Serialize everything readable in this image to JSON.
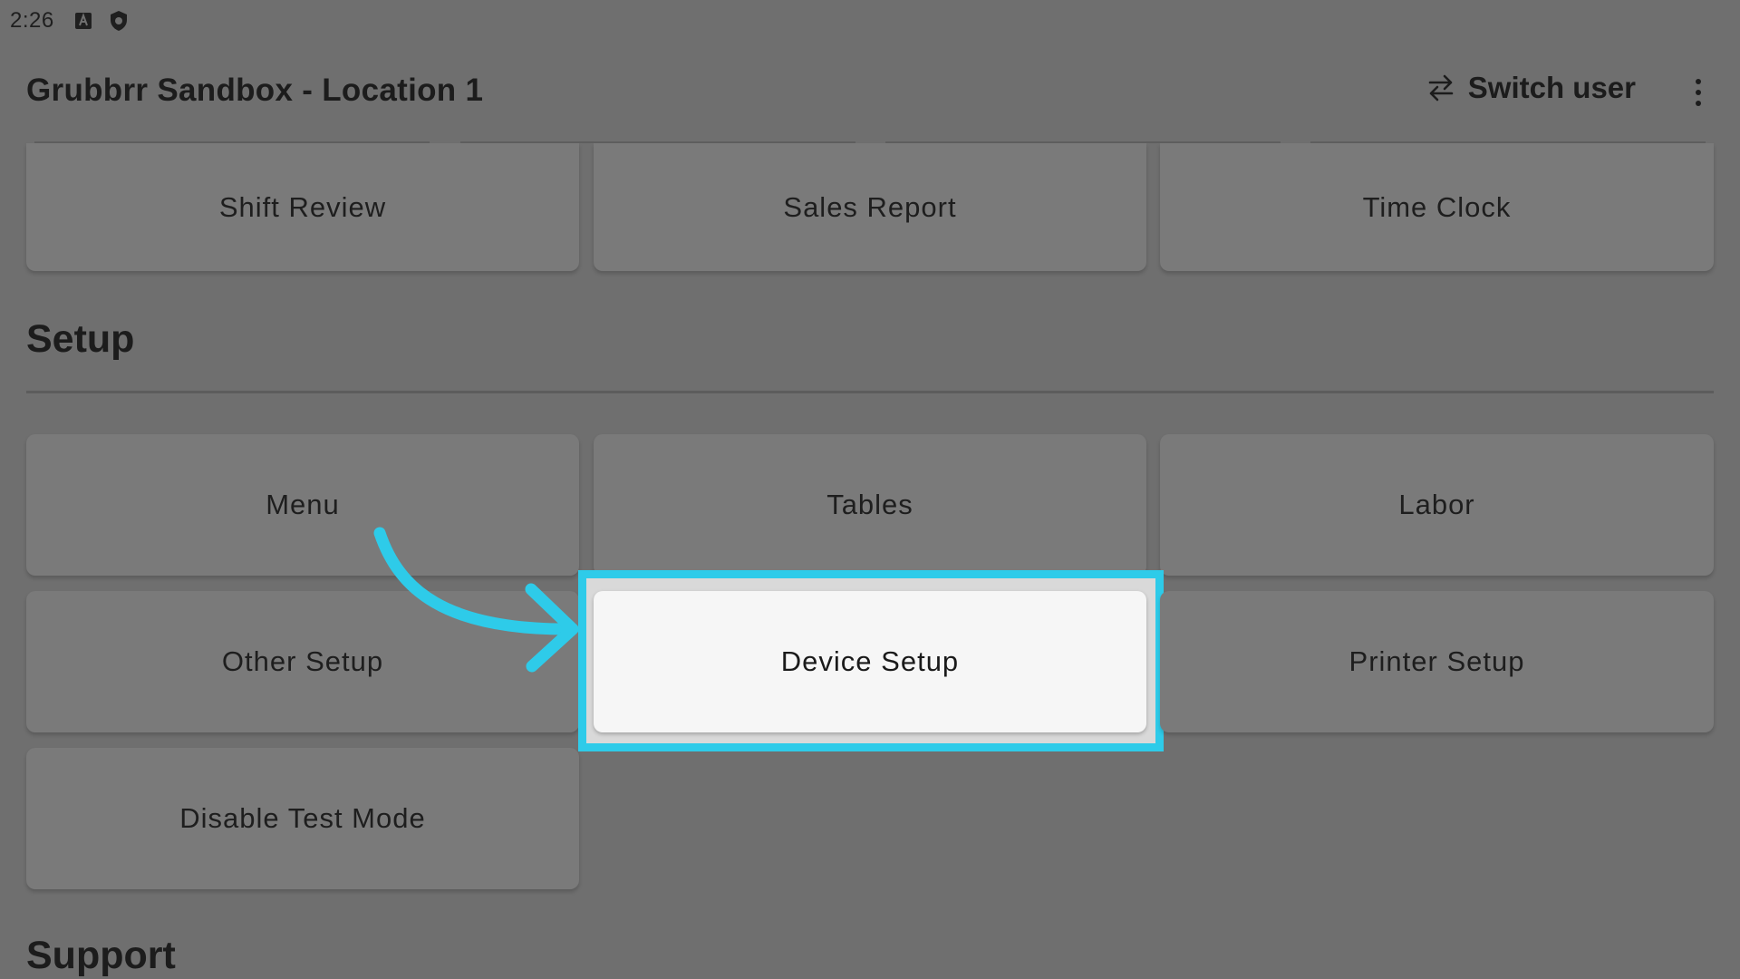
{
  "status_bar": {
    "time": "2:26",
    "icons": [
      "a-badge-icon",
      "shield-icon"
    ]
  },
  "app_bar": {
    "title": "Grubbrr Sandbox - Location 1",
    "switch_user_label": "Switch user",
    "switch_user_icon": "swap-arrows-icon",
    "menu_icon": "more-vert-icon"
  },
  "reports": {
    "items": [
      {
        "label": "Shift Review"
      },
      {
        "label": "Sales Report"
      },
      {
        "label": "Time Clock"
      }
    ]
  },
  "setup": {
    "title": "Setup",
    "items": [
      {
        "label": "Menu"
      },
      {
        "label": "Tables"
      },
      {
        "label": "Labor"
      },
      {
        "label": "Other Setup"
      },
      {
        "label": "Device Setup"
      },
      {
        "label": "Printer Setup"
      },
      {
        "label": "Disable Test Mode"
      }
    ],
    "highlighted": "Device Setup"
  },
  "support": {
    "title": "Support"
  },
  "colors": {
    "background": "#6f6f6f",
    "tile": "#7a7a7a",
    "highlight_tile": "#f6f6f6",
    "highlight_border": "#2ecbe9",
    "arrow": "#2ecbe9"
  }
}
